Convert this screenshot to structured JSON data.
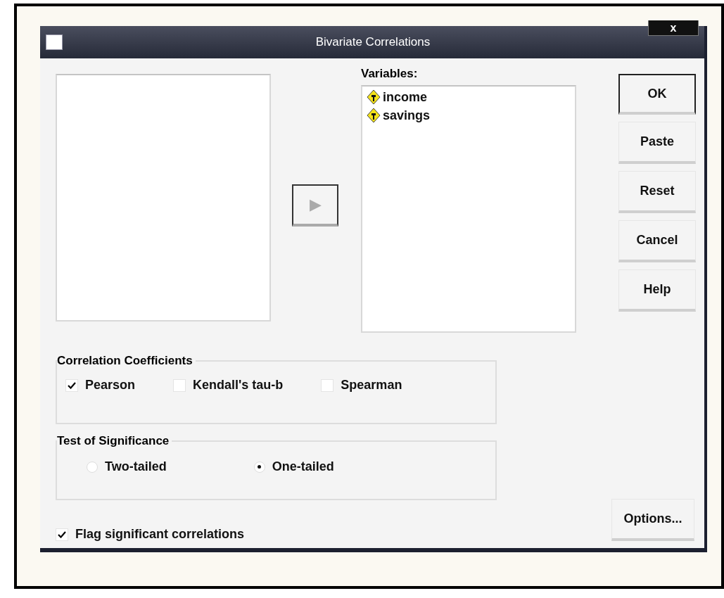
{
  "window": {
    "title": "Bivariate Correlations",
    "close": "x"
  },
  "move_button": {
    "glyph": "▶",
    "disabled": true
  },
  "variables": {
    "label": "Variables:",
    "items": [
      {
        "name": "income",
        "selected": false
      },
      {
        "name": "savings",
        "selected": false
      }
    ]
  },
  "buttons": [
    {
      "label": "OK",
      "default": true
    },
    {
      "label": "Paste",
      "default": false
    },
    {
      "label": "Reset",
      "default": false
    },
    {
      "label": "Cancel",
      "default": false
    },
    {
      "label": "Help",
      "default": false
    }
  ],
  "coefficients": {
    "title": "Correlation Coefficients",
    "options": [
      {
        "label": "Pearson",
        "checked": true
      },
      {
        "label": "Kendall's tau-b",
        "checked": false
      },
      {
        "label": "Spearman",
        "checked": false
      }
    ]
  },
  "significance": {
    "title": "Test of Significance",
    "options": [
      {
        "label": "Two-tailed",
        "selected": false
      },
      {
        "label": "One-tailed",
        "selected": true
      }
    ]
  },
  "flag": {
    "label": "Flag significant correlations",
    "checked": true
  },
  "options_button": {
    "label": "Options..."
  }
}
